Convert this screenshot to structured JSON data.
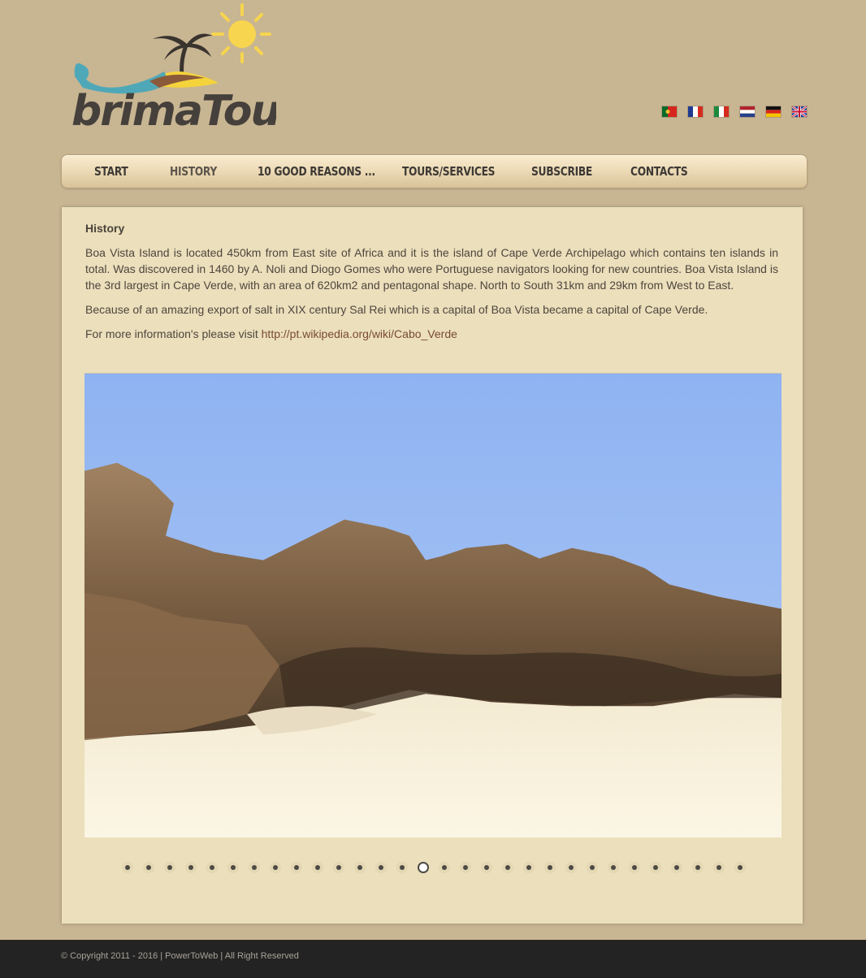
{
  "header": {
    "logo_text": "brimaTours",
    "languages": [
      {
        "code": "pt",
        "name": "Português"
      },
      {
        "code": "fr",
        "name": "Français"
      },
      {
        "code": "it",
        "name": "Italiano"
      },
      {
        "code": "nl",
        "name": "Nederlands"
      },
      {
        "code": "de",
        "name": "Deutsch"
      },
      {
        "code": "en",
        "name": "English"
      }
    ]
  },
  "nav": {
    "items": [
      {
        "label": "START",
        "active": false
      },
      {
        "label": "HISTORY",
        "active": true
      },
      {
        "label": "10 GOOD REASONS ...",
        "active": false
      },
      {
        "label": "TOURS/SERVICES",
        "active": false
      },
      {
        "label": "SUBSCRIBE",
        "active": false
      },
      {
        "label": "CONTACTS",
        "active": false
      }
    ]
  },
  "content": {
    "title": "History",
    "paragraph1": "Boa Vista Island is located 450km from East site of Africa and it is the island of Cape Verde Archipelago which contains ten islands in total. Was discovered in 1460 by A. Noli and Diogo Gomes who were Portuguese navigators looking for new countries. Boa Vista Island is the 3rd largest in Cape Verde, with an area of 620km2 and pentagonal shape. North to South 31km and 29km from West to East.",
    "paragraph2": "Because of an amazing export of salt in XIX century Sal Rei which is a capital of Boa Vista became a capital of Cape Verde.",
    "paragraph3_prefix": "For more information's please visit ",
    "paragraph3_link": "http://pt.wikipedia.org/wiki/Cabo_Verde"
  },
  "slideshow": {
    "total_slides": 30,
    "active_index": 14
  },
  "footer": {
    "copyright": "© Copyright 2011 - 2016 | PowerToWeb | All Right Reserved"
  }
}
